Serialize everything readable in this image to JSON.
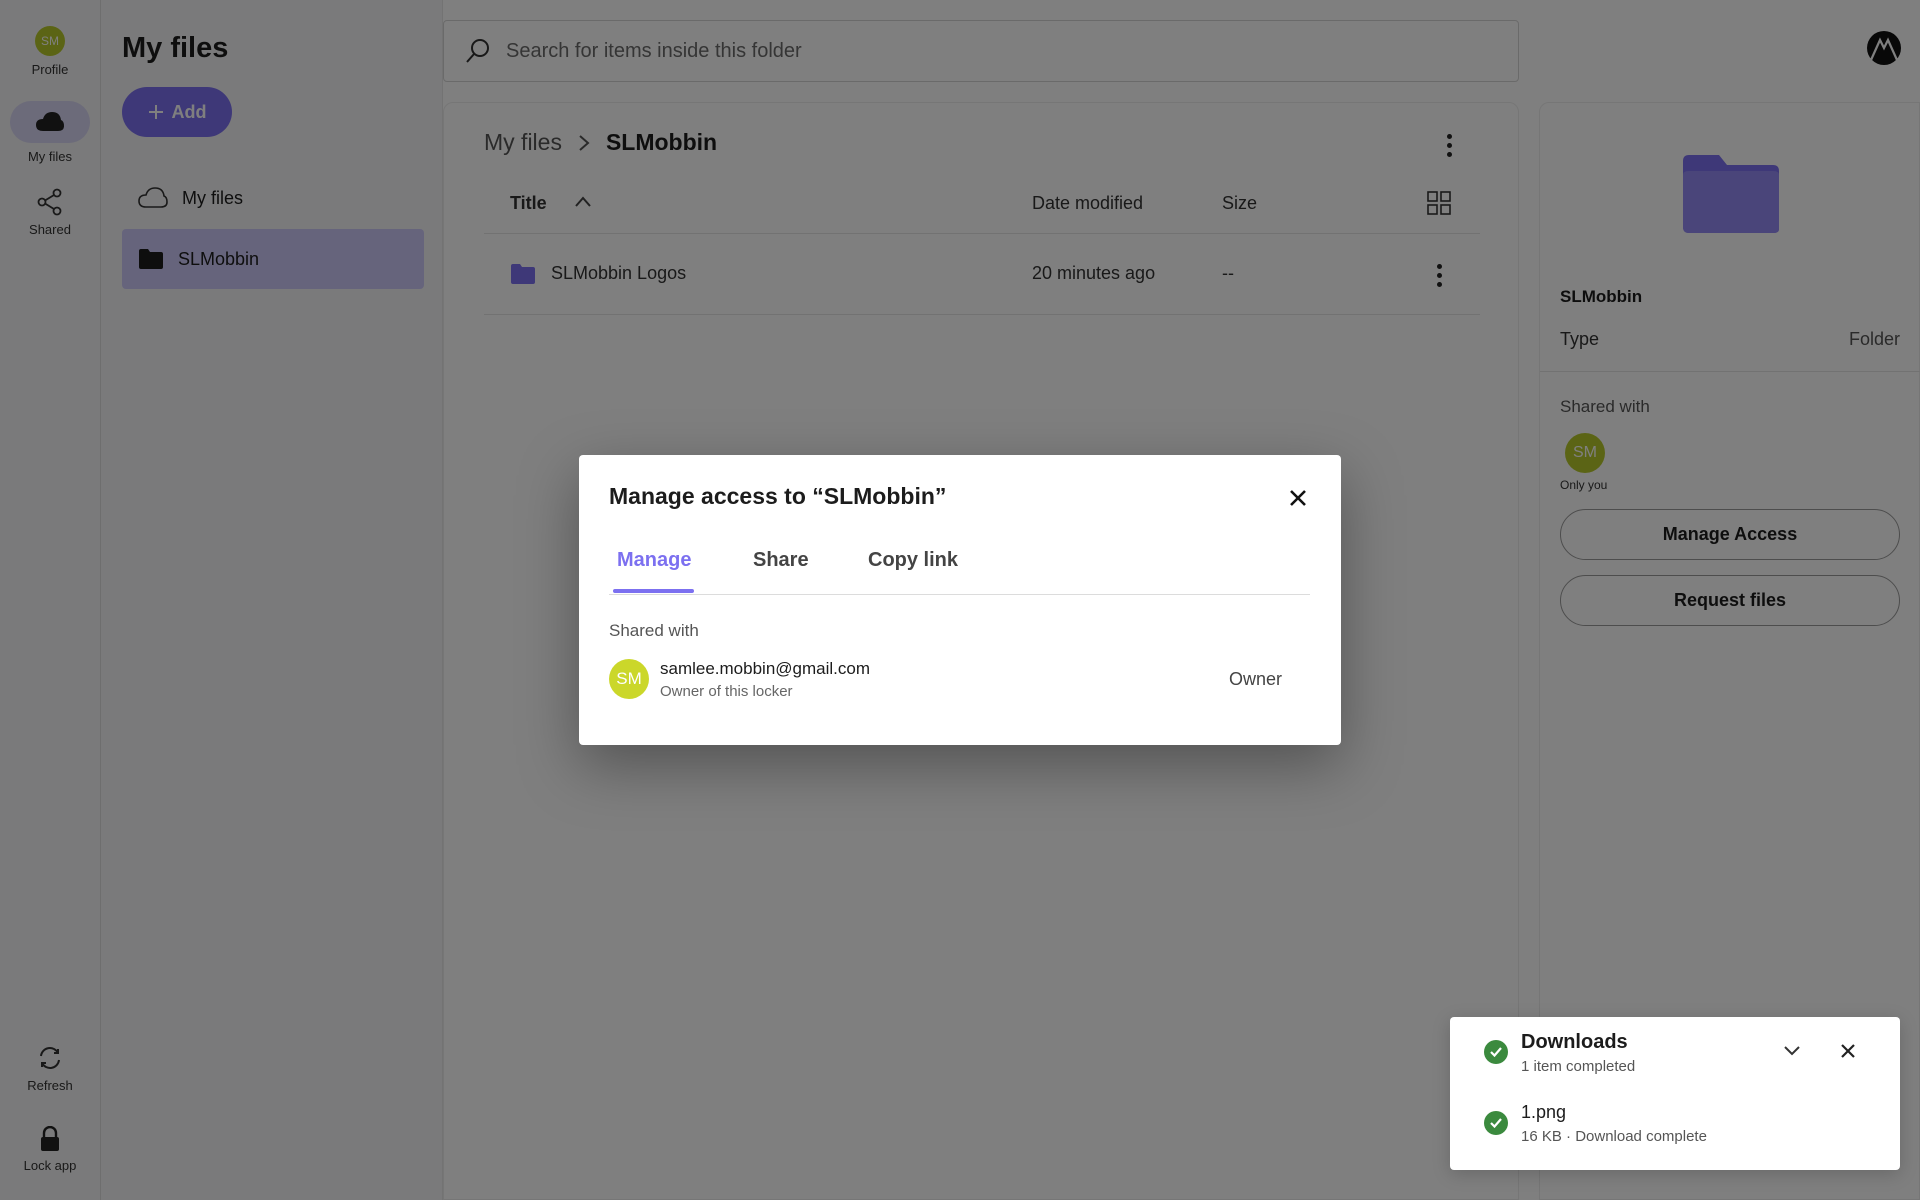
{
  "rail": {
    "profile": {
      "avatar": "SM",
      "label": "Profile"
    },
    "my_files": {
      "label": "My files"
    },
    "shared": {
      "label": "Shared"
    },
    "refresh": {
      "label": "Refresh"
    },
    "lock": {
      "label": "Lock app"
    }
  },
  "nav": {
    "title": "My files",
    "add_label": "Add",
    "items": [
      {
        "label": "My files",
        "icon": "cloud-icon",
        "active": false
      },
      {
        "label": "SLMobbin",
        "icon": "folder-icon",
        "active": true
      }
    ]
  },
  "search": {
    "placeholder": "Search for items inside this folder"
  },
  "breadcrumb": {
    "root": "My files",
    "current": "SLMobbin"
  },
  "table": {
    "headers": {
      "title": "Title",
      "date": "Date modified",
      "size": "Size"
    },
    "rows": [
      {
        "title": "SLMobbin Logos",
        "date": "20 minutes ago",
        "size": "--"
      }
    ]
  },
  "details": {
    "name": "SLMobbin",
    "type_label": "Type",
    "type_value": "Folder",
    "shared_with_label": "Shared with",
    "avatar": "SM",
    "only_you": "Only you",
    "manage_access": "Manage Access",
    "request_files": "Request files"
  },
  "modal": {
    "title": "Manage access to “SLMobbin”",
    "tabs": [
      "Manage",
      "Share",
      "Copy link"
    ],
    "active_tab": "Manage",
    "shared_with_label": "Shared with",
    "user": {
      "avatar": "SM",
      "email": "samlee.mobbin@gmail.com",
      "subtitle": "Owner of this locker",
      "role": "Owner"
    }
  },
  "downloads": {
    "title": "Downloads",
    "summary": "1 item completed",
    "items": [
      {
        "name": "1.png",
        "meta": "16 KB · Download complete"
      }
    ]
  },
  "colors": {
    "accent": "#7c70f0",
    "active_nav": "#cdc9f8",
    "avatar": "#b7c92b",
    "success": "#3b8a3e"
  }
}
